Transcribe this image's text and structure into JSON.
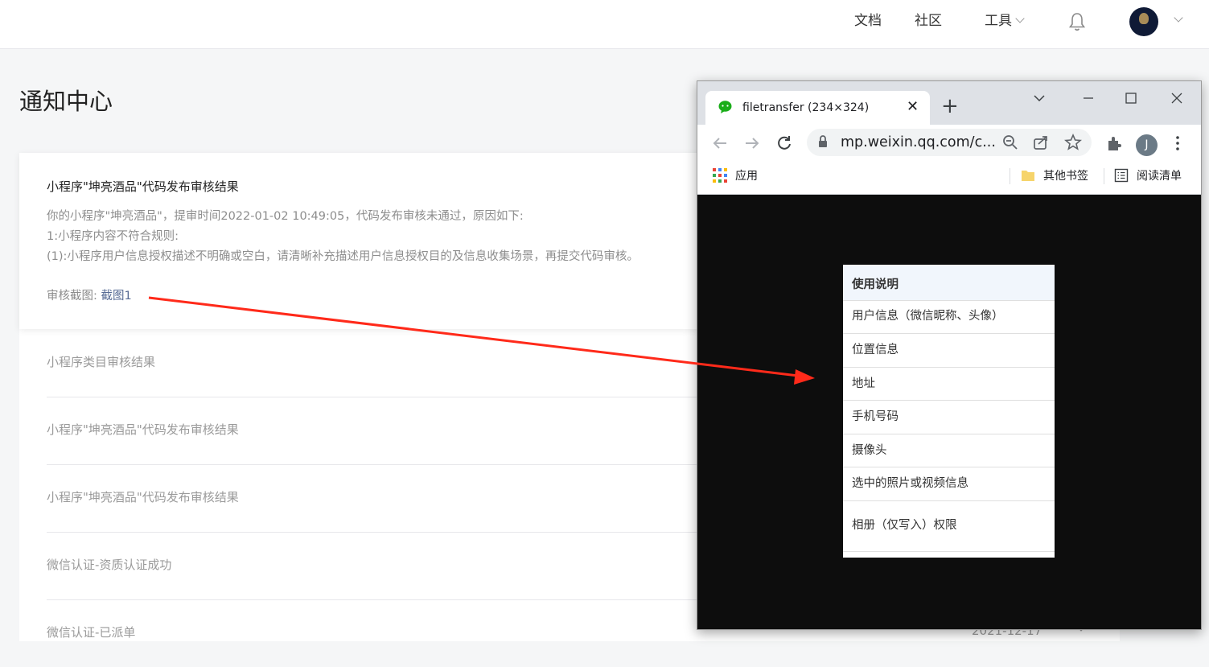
{
  "nav": {
    "docs": "文档",
    "community": "社区",
    "tools": "工具"
  },
  "page_title": "通知中心",
  "expanded_notice": {
    "title": "小程序\"坤亮酒品\"代码发布审核结果",
    "lines": [
      "你的小程序\"坤亮酒品\"，提审时间2022-01-02 10:49:05，代码发布审核未通过，原因如下:",
      "1:小程序内容不符合规则:",
      "(1):小程序用户信息授权描述不明确或空白，请清晰补充描述用户信息授权目的及信息收集场景，再提交代码审核。"
    ],
    "screenshot_label": "审核截图: ",
    "screenshot_link": "截图1"
  },
  "notices": [
    {
      "title": "小程序类目审核结果"
    },
    {
      "title": "小程序\"坤亮酒品\"代码发布审核结果"
    },
    {
      "title": "小程序\"坤亮酒品\"代码发布审核结果"
    },
    {
      "title": "微信认证-资质认证成功"
    },
    {
      "title": "微信认证-已派单",
      "date": "2021-12-17"
    }
  ],
  "browser": {
    "tab_title": "filetransfer (234×324)",
    "url": "mp.weixin.qq.com/c...",
    "profile_initial": "J",
    "bookmarks": {
      "apps": "应用",
      "other": "其他书签",
      "reading": "阅读清单"
    }
  },
  "popup_menu": {
    "header": "使用说明",
    "items": [
      "用户信息（微信昵称、头像）",
      "位置信息",
      "地址",
      "手机号码",
      "摄像头",
      "选中的照片或视频信息",
      "相册（仅写入）权限"
    ]
  },
  "colors": {
    "link": "#576b95",
    "arrow": "#ff2a1a",
    "wechat_green": "#1aad19"
  }
}
